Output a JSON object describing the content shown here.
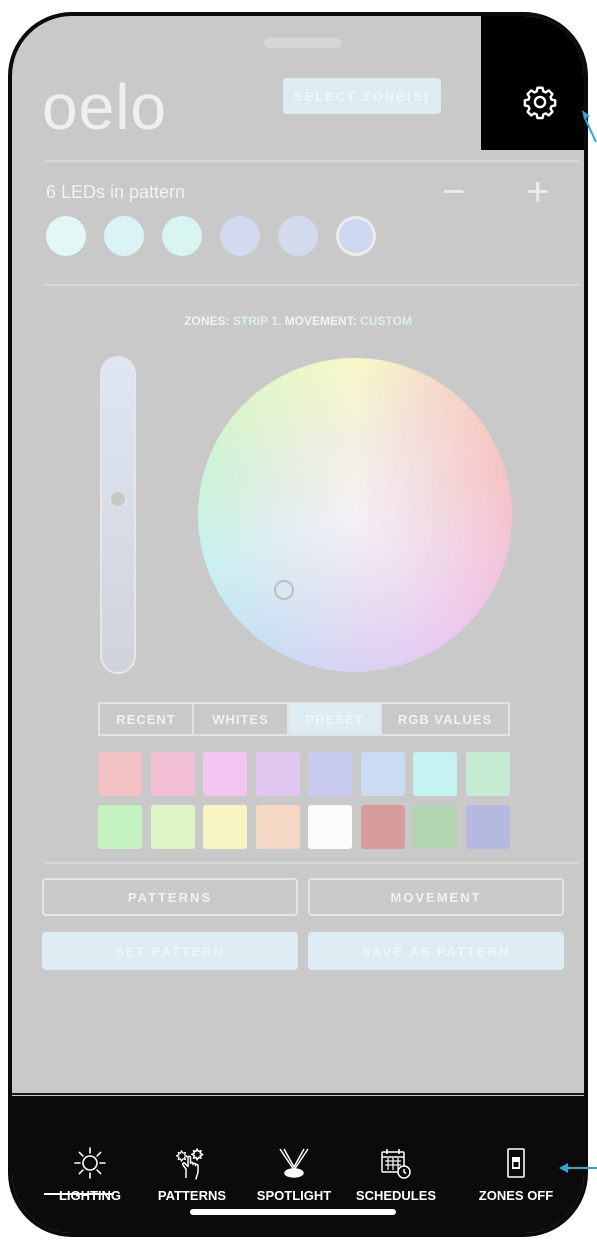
{
  "app": {
    "logo": "oelo"
  },
  "header": {
    "select_zone_label": "SELECT ZONE(S)",
    "settings_icon": "gear-icon"
  },
  "pattern": {
    "leds_label": "6 LEDs in pattern",
    "minus": "−",
    "plus": "+",
    "led_colors": [
      "#e3f7f7",
      "#daf3f6",
      "#d8f5f2",
      "#d3d9ee",
      "#d4daee",
      "#ced7f0"
    ]
  },
  "zones": {
    "prefix": "ZONES:",
    "zone": "STRIP 1.",
    "movement_prefix": "MOVEMENT:",
    "movement": "CUSTOM"
  },
  "color_tabs": [
    {
      "label": "RECENT",
      "active": false
    },
    {
      "label": "WHITES",
      "active": false
    },
    {
      "label": "PRESET",
      "active": true
    },
    {
      "label": "RGB VALUES",
      "active": false
    }
  ],
  "swatches_row1": [
    "#f1c1c4",
    "#f2bfd6",
    "#f5c5f1",
    "#e1c6ef",
    "#c9cbef",
    "#c9dcf2",
    "#c6f2f2",
    "#c5ecd3"
  ],
  "swatches_row2": [
    "#c5f2c1",
    "#e0f5c6",
    "#f8f5c2",
    "#f5d7c6",
    "#fcfcfc",
    "#d89b9b",
    "#b1d6b1",
    "#b6b8df"
  ],
  "buttons": {
    "patterns": "PATTERNS",
    "movement": "MOVEMENT",
    "set_pattern": "SET PATTERN",
    "save_as_pattern": "SAVE AS PATTERN"
  },
  "nav": [
    {
      "label": "LIGHTING",
      "icon": "sun-icon",
      "active": true
    },
    {
      "label": "PATTERNS",
      "icon": "hand-lights-icon",
      "active": false
    },
    {
      "label": "SPOTLIGHT",
      "icon": "spotlight-icon",
      "active": false
    },
    {
      "label": "SCHEDULES",
      "icon": "calendar-clock-icon",
      "active": false
    },
    {
      "label": "ZONES OFF",
      "icon": "switch-icon",
      "active": false
    }
  ],
  "accent_color": "#2ba9d6"
}
